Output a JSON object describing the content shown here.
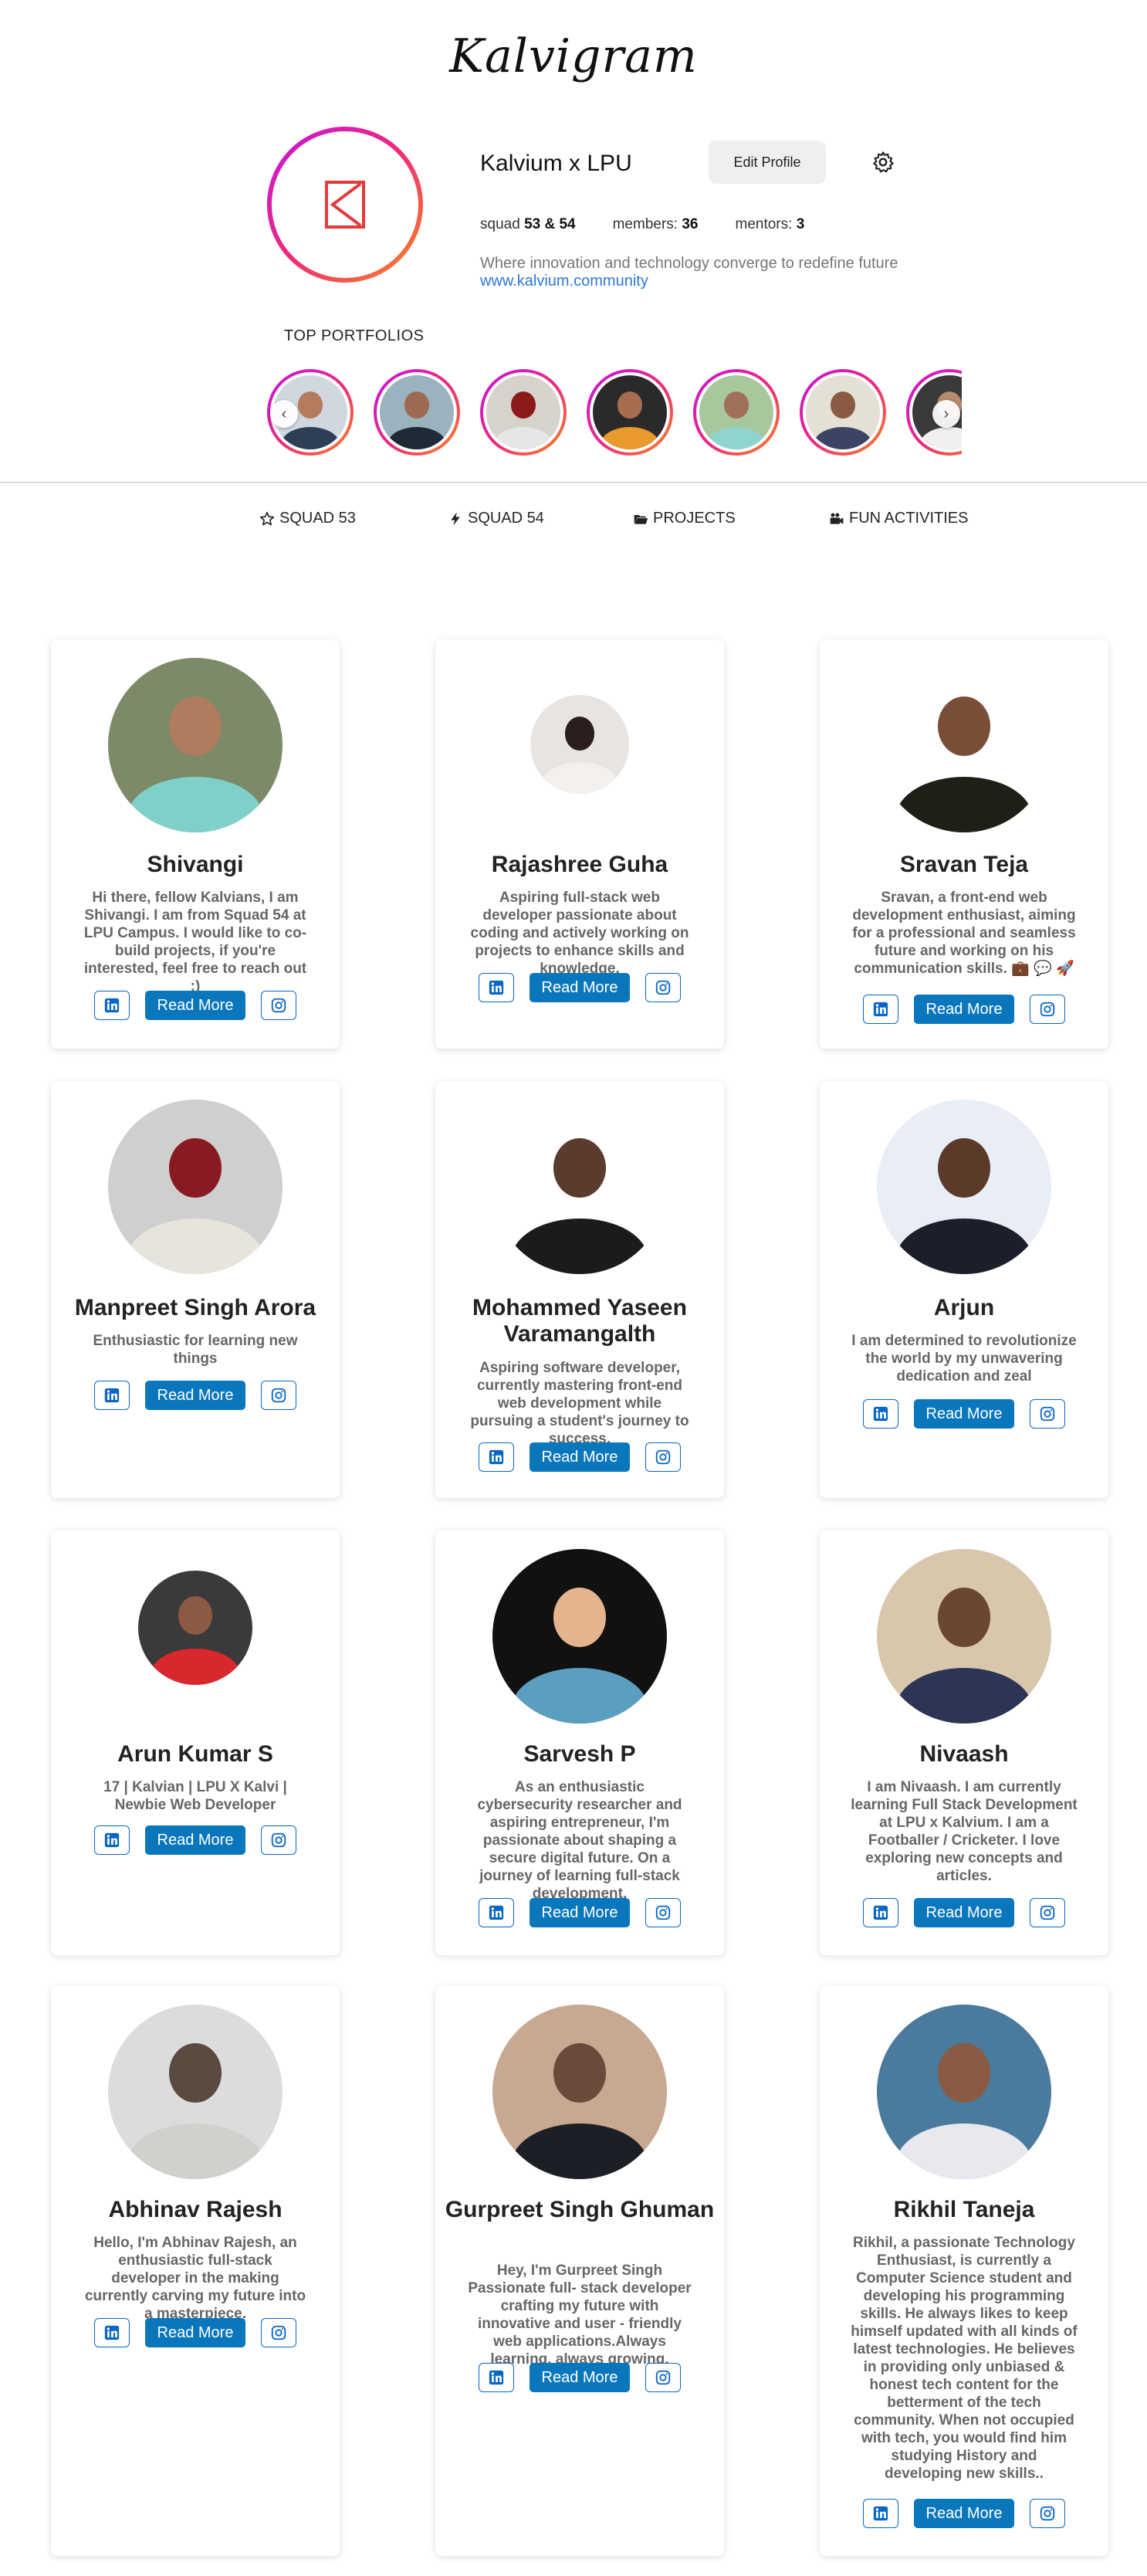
{
  "app": {
    "logo_text": "Kalvigram",
    "accent": "#0a77bd",
    "story_gradient": [
      "#c413e0",
      "#ef2b78",
      "#f98a1f"
    ]
  },
  "profile": {
    "avatar_icon": "kalvium-logo-icon",
    "name": "Kalvium x LPU",
    "edit_label": "Edit Profile",
    "settings_icon": "gear-icon",
    "stats": [
      {
        "label": "squad",
        "value": "53 & 54"
      },
      {
        "label": "members:",
        "value": "36"
      },
      {
        "label": "mentors:",
        "value": "3"
      }
    ],
    "bio": "Where innovation and technology converge to redefine future",
    "website": "www.kalvium.community"
  },
  "top_portfolios": {
    "label": "TOP PORTFOLIOS",
    "prev_icon": "chevron-left-icon",
    "next_icon": "chevron-right-icon"
  },
  "tabs": [
    {
      "label": "SQUAD 53",
      "icon": "star-icon"
    },
    {
      "label": "SQUAD 54",
      "icon": "bolt-icon"
    },
    {
      "label": "PROJECTS",
      "icon": "folder-open-icon"
    },
    {
      "label": "FUN ACTIVITIES",
      "icon": "video-camera-icon"
    }
  ],
  "cards": [
    {
      "name": "Shivangi",
      "desc": "Hi there, fellow Kalvians, I am Shivangi. I am from Squad 54 at LPU Campus. I would like to co-build projects, if you're interested, feel free to reach out :)",
      "linkedin_icon": "linkedin-icon",
      "read_label": "Read More",
      "instagram_icon": "instagram-icon"
    },
    {
      "name": "Rajashree Guha",
      "desc": "Aspiring full-stack web developer passionate about coding and actively working on projects to enhance skills and knowledge.",
      "linkedin_icon": "linkedin-icon",
      "read_label": "Read More",
      "instagram_icon": "instagram-icon"
    },
    {
      "name": "Sravan Teja",
      "desc": "Sravan, a front-end web development enthusiast, aiming for a professional and seamless future and working on his communication skills. 💼 💬 🚀",
      "linkedin_icon": "linkedin-icon",
      "read_label": "Read More",
      "instagram_icon": "instagram-icon"
    },
    {
      "name": "Manpreet Singh Arora",
      "desc": "Enthusiastic for learning new things",
      "linkedin_icon": "linkedin-icon",
      "read_label": "Read More",
      "instagram_icon": "instagram-icon"
    },
    {
      "name": "Mohammed Yaseen Varamangalth",
      "desc": "Aspiring software developer, currently mastering front-end web development while pursuing a student's journey to success.",
      "linkedin_icon": "linkedin-icon",
      "read_label": "Read More",
      "instagram_icon": "instagram-icon"
    },
    {
      "name": "Arjun",
      "desc": "I am determined to revolutionize the world by my unwavering dedication and zeal",
      "linkedin_icon": "linkedin-icon",
      "read_label": "Read More",
      "instagram_icon": "instagram-icon"
    },
    {
      "name": "Arun Kumar S",
      "desc": "17 | Kalvian | LPU X Kalvi | Newbie Web Developer",
      "linkedin_icon": "linkedin-icon",
      "read_label": "Read More",
      "instagram_icon": "instagram-icon"
    },
    {
      "name": "Sarvesh P",
      "desc": "As an enthusiastic cybersecurity researcher and aspiring entrepreneur, I'm passionate about shaping a secure digital future. On a journey of learning full-stack development.",
      "linkedin_icon": "linkedin-icon",
      "read_label": "Read More",
      "instagram_icon": "instagram-icon"
    },
    {
      "name": "Nivaash",
      "desc": "I am Nivaash. I am currently learning Full Stack Development at LPU x Kalvium. I am a Footballer / Cricketer. I love exploring new concepts and articles.",
      "linkedin_icon": "linkedin-icon",
      "read_label": "Read More",
      "instagram_icon": "instagram-icon"
    },
    {
      "name": "Abhinav Rajesh",
      "desc": "Hello, I'm Abhinav Rajesh, an enthusiastic full-stack developer in the making currently carving my future into a masterpiece.",
      "linkedin_icon": "linkedin-icon",
      "read_label": "Read More",
      "instagram_icon": "instagram-icon"
    },
    {
      "name": "Gurpreet Singh Ghuman",
      "desc": "Hey, I'm Gurpreet Singh Passionate full- stack developer crafting my future with innovative and user - friendly web applications.Always learning, always growing.",
      "linkedin_icon": "linkedin-icon",
      "read_label": "Read More",
      "instagram_icon": "instagram-icon"
    },
    {
      "name": "Rikhil Taneja",
      "desc": "Rikhil, a passionate Technology Enthusiast, is currently a Computer Science student and developing his programming skills. He always likes to keep himself updated with all kinds of latest technologies. He believes in providing only unbiased & honest tech content for the betterment of the tech community. When not occupied with tech, you would find him studying History and developing new skills..",
      "linkedin_icon": "linkedin-icon",
      "read_label": "Read More",
      "instagram_icon": "instagram-icon"
    }
  ]
}
